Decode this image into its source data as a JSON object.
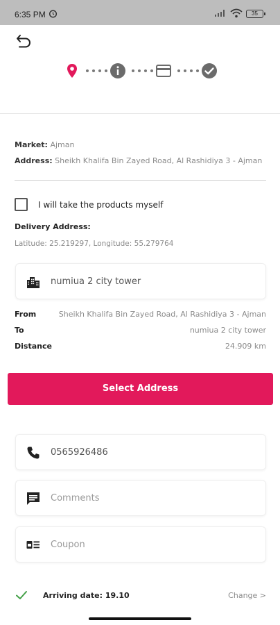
{
  "status_bar": {
    "time": "6:35 PM",
    "battery": "35"
  },
  "market": {
    "label": "Market:",
    "value": "Ajman"
  },
  "address": {
    "label": "Address:",
    "value": "Sheikh Khalifa Bin Zayed Road, Al Rashidiya 3 - Ajman"
  },
  "take_products": {
    "label": "I will take the products myself",
    "checked": false
  },
  "delivery": {
    "title": "Delivery Address:",
    "latlong": "Latitude: 25.219297, Longitude: 55.279764",
    "building": "numiua 2 city tower"
  },
  "route": {
    "from_label": "From",
    "from_value": "Sheikh Khalifa Bin Zayed Road, Al Rashidiya 3 - Ajman",
    "to_label": "To",
    "to_value": "numiua 2 city tower",
    "distance_label": "Distance",
    "distance_value": "24.909 km"
  },
  "select_address_button": "Select Address",
  "phone": {
    "value": "0565926486"
  },
  "comments": {
    "placeholder": "Comments"
  },
  "coupon": {
    "placeholder": "Coupon"
  },
  "arriving": {
    "label": "Arriving date:",
    "date": "19.10",
    "change": "Change >"
  },
  "colors": {
    "accent": "#e2195b",
    "check_green": "#43a047",
    "step_inactive": "#6b6b6b"
  },
  "stepper": {
    "icons": [
      "location-pin-icon",
      "info-icon",
      "credit-card-icon",
      "check-circle-icon"
    ]
  }
}
